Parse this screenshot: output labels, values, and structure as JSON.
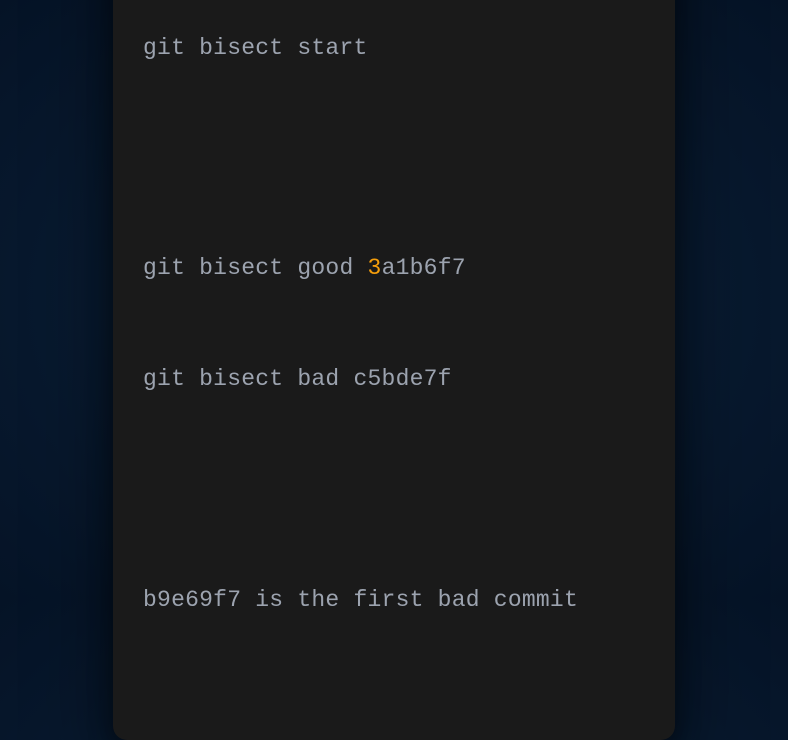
{
  "window": {
    "traffic": {
      "red": "#ec5a55",
      "yellow": "#f0bc2d",
      "green": "#26c83e"
    }
  },
  "terminal": {
    "lines": {
      "l1": "git bisect start",
      "l2_pre": "git bisect good ",
      "l2_hl": "3",
      "l2_post": "a1b6f7",
      "l3": "git bisect bad c5bde7f",
      "l4": "b9e69f7 is the first bad commit"
    }
  }
}
